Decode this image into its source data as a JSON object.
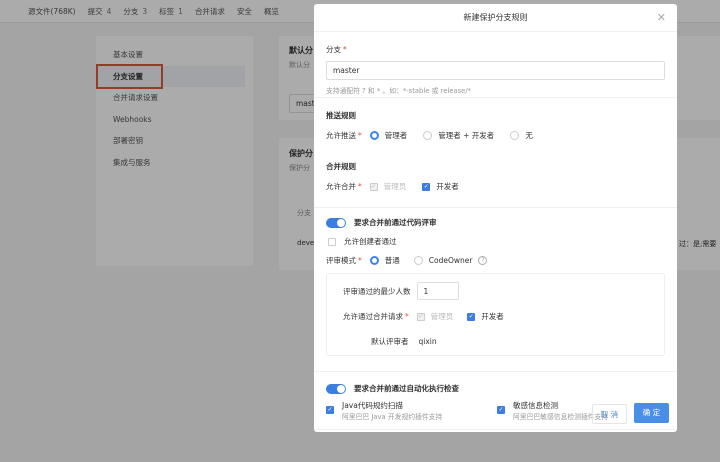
{
  "topnav": [
    {
      "label": "源文件(768K)"
    },
    {
      "label": "提交",
      "count": "4"
    },
    {
      "label": "分支",
      "count": "3"
    },
    {
      "label": "标签",
      "count": "1"
    },
    {
      "label": "合并请求"
    },
    {
      "label": "安全"
    },
    {
      "label": "概览"
    }
  ],
  "sidebar": {
    "items": [
      "基本设置",
      "分支设置",
      "合并请求设置",
      "Webhooks",
      "部署密钥",
      "集成与服务"
    ],
    "active": "分支设置"
  },
  "background": {
    "default_title": "默认分",
    "default_sub": "默认分",
    "default_value": "mast",
    "protect_title": "保护分",
    "protect_sub": "保护分",
    "col_branch": "分支",
    "row_branch": "devel",
    "row_tail": "过：是;需要"
  },
  "modal": {
    "title": "新建保护分支规则",
    "branch_label": "分支",
    "branch_value": "master",
    "branch_hint": "支持通配符 ? 和 * 。如：*-stable 或 release/*",
    "push_title": "推送规则",
    "push_label": "允许推送",
    "push_options": [
      "管理者",
      "管理者 + 开发者",
      "无"
    ],
    "push_selected": "管理者",
    "merge_title": "合并规则",
    "merge_label": "允许合并",
    "merge_options": [
      {
        "label": "管理员",
        "checked": true,
        "disabled": true
      },
      {
        "label": "开发者",
        "checked": true,
        "disabled": false
      }
    ],
    "review_toggle": "要求合并前通过代码评审",
    "review_toggle_on": true,
    "allow_creator": "允许创建者通过",
    "allow_creator_checked": false,
    "review_mode_label": "评审模式",
    "review_modes": [
      "普通",
      "CodeOwner"
    ],
    "review_mode_selected": "普通",
    "min_reviewers_label": "评审通过的最少人数",
    "min_reviewers_value": "1",
    "allow_pass_label": "允许通过合并请求",
    "allow_pass_options": [
      {
        "label": "管理员",
        "checked": true,
        "disabled": true
      },
      {
        "label": "开发者",
        "checked": true,
        "disabled": false
      }
    ],
    "default_reviewer_label": "默认评审者",
    "default_reviewer_value": "qixin",
    "auto_toggle": "要求合并前通过自动化执行检查",
    "auto_toggle_on": true,
    "checks": [
      {
        "title": "Java代码规约扫描",
        "desc": "阿里巴巴 Java 开发规约插件支持",
        "checked": true
      },
      {
        "title": "敏感信息检测",
        "desc": "阿里巴巴敏感信息检测插件支持",
        "checked": true
      }
    ],
    "cancel": "取 消",
    "ok": "确 定"
  },
  "colors": {
    "accent": "#3b7ee0",
    "required": "#e04a3a",
    "highlight": "#e05a3a"
  }
}
